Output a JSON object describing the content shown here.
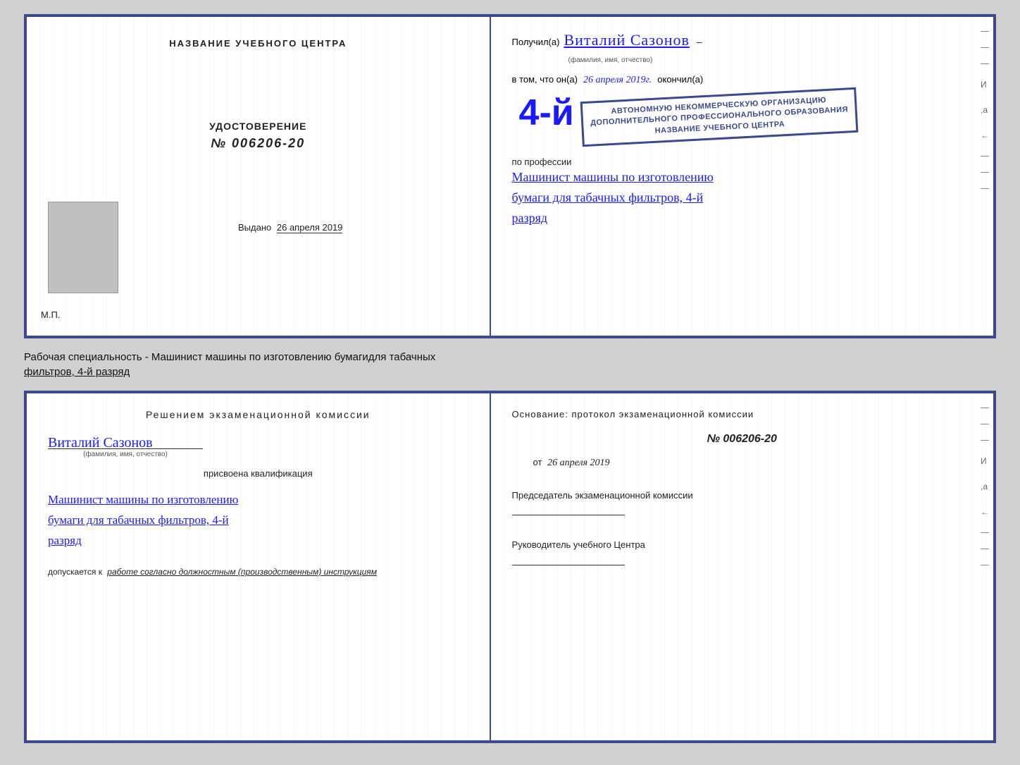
{
  "top_cert": {
    "left": {
      "title": "НАЗВАНИЕ УЧЕБНОГО ЦЕНТРА",
      "cert_label": "УДОСТОВЕРЕНИЕ",
      "cert_number": "№ 006206-20",
      "issued_label": "Выдано",
      "issued_date": "26 апреля 2019",
      "mp_label": "М.П."
    },
    "right": {
      "poluchil_prefix": "Получил(а)",
      "handwritten_name": "Виталий Сазонов",
      "fio_note": "(фамилия, имя, отчество)",
      "vtom_prefix": "в том, что он(а)",
      "handwritten_date": "26 апреля 2019г.",
      "okonchil": "окончил(а)",
      "big4": "4-й",
      "org_line1": "АВТОНОМНУЮ НЕКОММЕРЧЕСКУЮ ОРГАНИЗАЦИЮ",
      "org_line2": "ДОПОЛНИТЕЛЬНОГО ПРОФЕССИОНАЛЬНОГО ОБРАЗОВАНИЯ",
      "org_line3": "\" НАЗВАНИЕ УЧЕБНОГО ЦЕНТРА \"",
      "stamp_line1": "АВТОНОМНУЮ НЕКОММЕРЧЕСКУЮ ОРГАНИЗАЦИЮ",
      "stamp_line2": "ДОПОЛНИТЕЛЬНОГО ПРОФЕССИОНАЛЬНОГО ОБРАЗОВАНИЯ",
      "stamp_line3": "НАЗВАНИЕ УЧЕБНОГО ЦЕНТРА",
      "po_professii": "по профессии",
      "profession_line1": "Машинист машины по изготовлению",
      "profession_line2": "бумаги для табачных фильтров, 4-й",
      "profession_line3": "разряд"
    }
  },
  "between_label": {
    "line1": "Рабочая специальность - Машинист машины по изготовлению бумагидля табачных",
    "line2": "фильтров, 4-й разряд"
  },
  "bottom_cert": {
    "left": {
      "commission_title": "Решением экзаменационной комиссии",
      "handwritten_name": "Виталий Сазонов",
      "fio_note": "(фамилия, имя, отчество)",
      "prisvoena": "присвоена квалификация",
      "prof_line1": "Машинист машины по изготовлению",
      "prof_line2": "бумаги для табачных фильтров, 4-й",
      "prof_line3": "разряд",
      "dopusk_prefix": "допускается к",
      "dopusk_italic": "работе согласно должностным (производственным) инструкциям"
    },
    "right": {
      "osnov_label": "Основание: протокол экзаменационной комиссии",
      "protocol_number": "№  006206-20",
      "date_prefix": "от",
      "date_value": "26 апреля 2019",
      "chairman_label": "Председатель экзаменационной комиссии",
      "rukovoditel_label": "Руководитель учебного Центра"
    }
  },
  "edge_dashes": [
    "–",
    "–",
    "–",
    "И",
    ",а",
    "←",
    "–",
    "–",
    "–"
  ]
}
